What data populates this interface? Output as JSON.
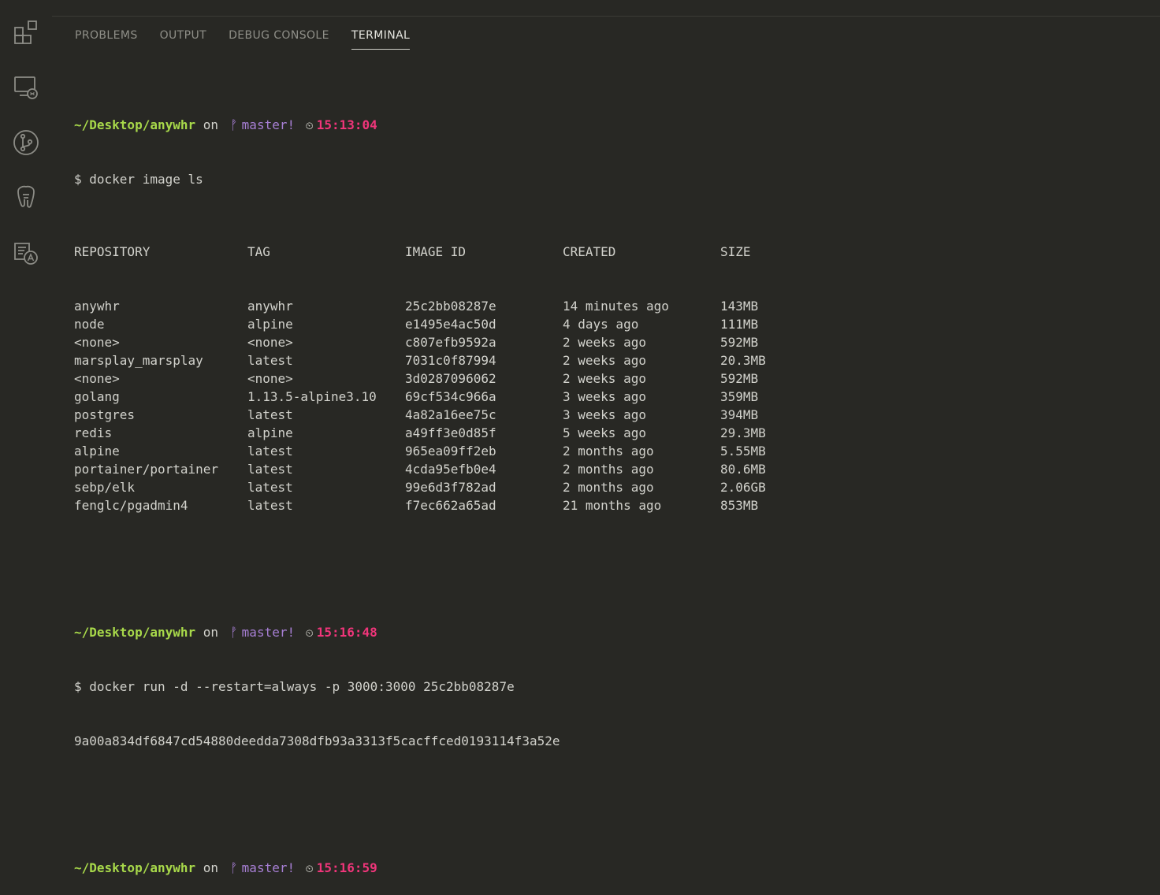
{
  "activity_bar": [
    {
      "name": "extensions-icon"
    },
    {
      "name": "remote-explorer-icon"
    },
    {
      "name": "source-control-icon"
    },
    {
      "name": "postgresql-icon"
    },
    {
      "name": "translate-icon"
    }
  ],
  "panel": {
    "tabs": [
      {
        "label": "PROBLEMS",
        "active": false
      },
      {
        "label": "OUTPUT",
        "active": false
      },
      {
        "label": "DEBUG CONSOLE",
        "active": false
      },
      {
        "label": "TERMINAL",
        "active": true
      }
    ]
  },
  "terminal": {
    "prompts": [
      {
        "path": "~/Desktop/anywhr",
        "on": "on",
        "branch": "master!",
        "time": "15:13:04",
        "command": "$ docker image ls"
      },
      {
        "path": "~/Desktop/anywhr",
        "on": "on",
        "branch": "master!",
        "time": "15:16:48",
        "command": "$ docker run -d --restart=always -p 3000:3000 25c2bb08287e",
        "output": "9a00a834df6847cd54880deedda7308dfb93a3313f5cacffced0193114f3a52e"
      },
      {
        "path": "~/Desktop/anywhr",
        "on": "on",
        "branch": "master!",
        "time": "15:16:59"
      }
    ],
    "table": {
      "headers": [
        "REPOSITORY",
        "TAG",
        "IMAGE ID",
        "CREATED",
        "SIZE"
      ],
      "rows": [
        [
          "anywhr",
          "anywhr",
          "25c2bb08287e",
          "14 minutes ago",
          "143MB"
        ],
        [
          "node",
          "alpine",
          "e1495e4ac50d",
          "4 days ago",
          "111MB"
        ],
        [
          "<none>",
          "<none>",
          "c807efb9592a",
          "2 weeks ago",
          "592MB"
        ],
        [
          "marsplay_marsplay",
          "latest",
          "7031c0f87994",
          "2 weeks ago",
          "20.3MB"
        ],
        [
          "<none>",
          "<none>",
          "3d0287096062",
          "2 weeks ago",
          "592MB"
        ],
        [
          "golang",
          "1.13.5-alpine3.10",
          "69cf534c966a",
          "3 weeks ago",
          "359MB"
        ],
        [
          "postgres",
          "latest",
          "4a82a16ee75c",
          "3 weeks ago",
          "394MB"
        ],
        [
          "redis",
          "alpine",
          "a49ff3e0d85f",
          "5 weeks ago",
          "29.3MB"
        ],
        [
          "alpine",
          "latest",
          "965ea09ff2eb",
          "2 months ago",
          "5.55MB"
        ],
        [
          "portainer/portainer",
          "latest",
          "4cda95efb0e4",
          "2 months ago",
          "80.6MB"
        ],
        [
          "sebp/elk",
          "latest",
          "99e6d3f782ad",
          "2 months ago",
          "2.06GB"
        ],
        [
          "fenglc/pgadmin4",
          "latest",
          "f7ec662a65ad",
          "21 months ago",
          "853MB"
        ]
      ]
    }
  }
}
